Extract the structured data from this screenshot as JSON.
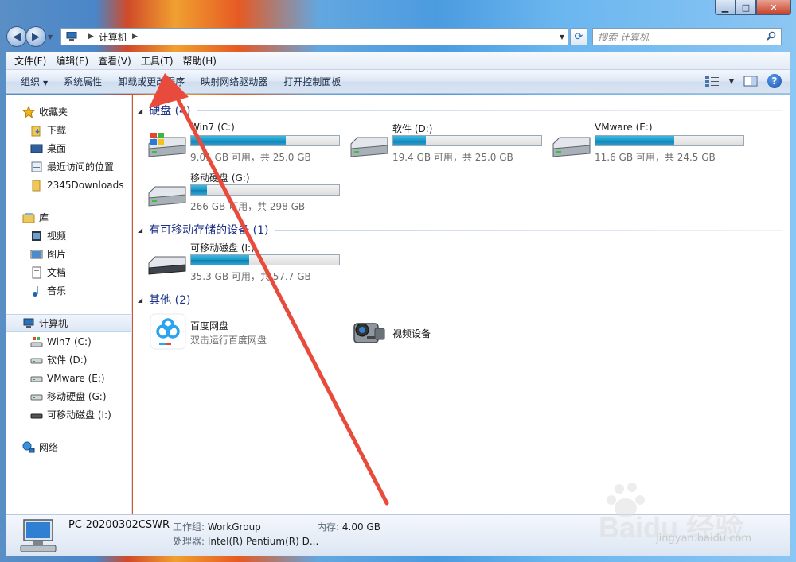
{
  "window": {
    "controls": {
      "minimize": "▁",
      "maximize": "□",
      "close": "✕"
    }
  },
  "address": {
    "path": "计算机",
    "search_placeholder": "搜索 计算机"
  },
  "menubar": {
    "items": [
      "文件(F)",
      "编辑(E)",
      "查看(V)",
      "工具(T)",
      "帮助(H)"
    ]
  },
  "commandbar": {
    "organize": "组织",
    "items": [
      "系统属性",
      "卸载或更改程序",
      "映射网络驱动器",
      "打开控制面板"
    ]
  },
  "navigation": {
    "favorites": {
      "label": "收藏夹",
      "items": [
        "下载",
        "桌面",
        "最近访问的位置",
        "2345Downloads"
      ]
    },
    "libraries": {
      "label": "库",
      "items": [
        "视频",
        "图片",
        "文档",
        "音乐"
      ]
    },
    "computer": {
      "label": "计算机",
      "items": [
        "Win7 (C:)",
        "软件 (D:)",
        "VMware (E:)",
        "移动硬盘 (G:)",
        "可移动磁盘 (I:)"
      ]
    },
    "network": {
      "label": "网络"
    }
  },
  "sections": {
    "hard_disks": {
      "title": "硬盘 (4)",
      "drives": [
        {
          "name": "Win7 (C:)",
          "info": "9.01 GB 可用，共 25.0 GB",
          "used_fraction": 0.64
        },
        {
          "name": "软件 (D:)",
          "info": "19.4 GB 可用，共 25.0 GB",
          "used_fraction": 0.22
        },
        {
          "name": "VMware (E:)",
          "info": "11.6 GB 可用，共 24.5 GB",
          "used_fraction": 0.53
        },
        {
          "name": "移动硬盘 (G:)",
          "info": "266 GB 可用，共 298 GB",
          "used_fraction": 0.11
        }
      ]
    },
    "removable": {
      "title": "有可移动存储的设备 (1)",
      "drives": [
        {
          "name": "可移动磁盘 (I:)",
          "info": "35.3 GB 可用，共 57.7 GB",
          "used_fraction": 0.39
        }
      ]
    },
    "other": {
      "title": "其他 (2)",
      "items": [
        {
          "name": "百度网盘",
          "sub": "双击运行百度网盘"
        },
        {
          "name": "视频设备",
          "sub": ""
        }
      ]
    }
  },
  "details": {
    "pc_name": "PC-20200302CSWR",
    "workgroup_label": "工作组:",
    "workgroup_value": "WorkGroup",
    "memory_label": "内存:",
    "memory_value": "4.00 GB",
    "cpu_label": "处理器:",
    "cpu_value": "Intel(R) Pentium(R) D..."
  },
  "watermark": {
    "logo": "Baidu 经验",
    "url": "jingyan.baidu.com"
  },
  "colors": {
    "accent": "#1e3287",
    "bar_fill": "#1a95c5",
    "arrow": "#e84a3c"
  }
}
